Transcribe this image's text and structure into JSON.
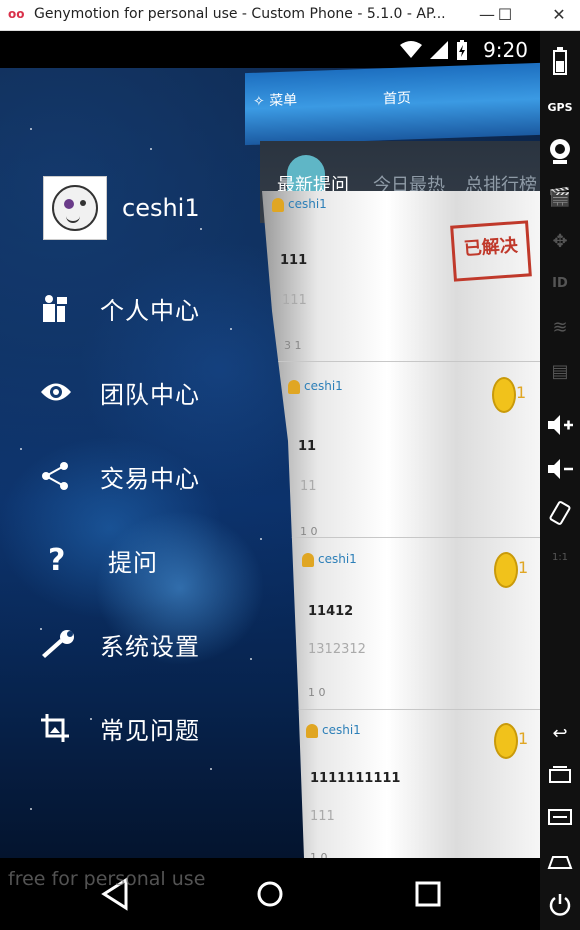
{
  "window": {
    "title": "Genymotion for personal use - Custom Phone - 5.1.0 - AP...",
    "app_icon": "oo",
    "controls": [
      "—",
      "☐",
      "✕"
    ]
  },
  "statusbar": {
    "time": "9:20"
  },
  "drawer": {
    "username": "ceshi1",
    "menu": [
      {
        "icon": "person-icon",
        "label": "个人中心"
      },
      {
        "icon": "eye-icon",
        "label": "团队中心"
      },
      {
        "icon": "share-icon",
        "label": "交易中心"
      },
      {
        "icon": "question-icon",
        "label": "提问"
      },
      {
        "icon": "wrench-icon",
        "label": "系统设置"
      },
      {
        "icon": "crop-icon",
        "label": "常见问题"
      }
    ]
  },
  "panel": {
    "header_menu": "菜单",
    "header_home": "首页",
    "tabs": [
      "最新提问",
      "今日最热",
      "总排行榜"
    ],
    "stamp": "已解决",
    "cards": [
      {
        "user": "ceshi1",
        "title": "111",
        "body": "111",
        "stats": "3  1",
        "coin": ""
      },
      {
        "user": "ceshi1",
        "title": "11",
        "body": "11",
        "stats": "1  0",
        "coin": "1"
      },
      {
        "user": "ceshi1",
        "title": "11412",
        "body": "1312312",
        "stats": "1  0",
        "coin": "1"
      },
      {
        "user": "ceshi1",
        "title": "1111111111",
        "body": "111",
        "stats": "1  0",
        "coin": "1"
      }
    ]
  },
  "watermark": "free for personal use",
  "colors": {
    "accent_blue": "#2c7fb8",
    "coin_gold": "#e0a623",
    "stamp_red": "#c0392b",
    "tab_active_circle": "#5fb6c6"
  }
}
